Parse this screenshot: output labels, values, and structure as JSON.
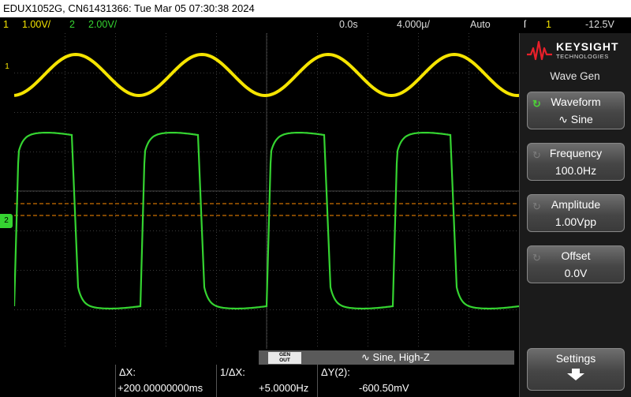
{
  "title_bar": {
    "text": "EDUX1052G, CN61431366: Tue Mar 05 07:30:38 2024"
  },
  "status_bar": {
    "ch1_num": "1",
    "ch1_scale": "1.00V/",
    "ch2_num": "2",
    "ch2_scale": "2.00V/",
    "time_offset": "0.0s",
    "time_scale": "4.000µ/",
    "trigger_mode": "Auto",
    "trigger_icon": "ſ",
    "trigger_source": "1",
    "trigger_level": "-12.5V"
  },
  "markers": {
    "ch1": "1",
    "ch2": "2"
  },
  "side_panel": {
    "brand": "KEYSIGHT",
    "brand_sub": "TECHNOLOGIES",
    "title": "Wave Gen",
    "softkeys": [
      {
        "label": "Waveform",
        "value": "∿ Sine",
        "icon": "rotate-knob-icon"
      },
      {
        "label": "Frequency",
        "value": "100.0Hz",
        "icon": "rotate-knob-icon"
      },
      {
        "label": "Amplitude",
        "value": "1.00Vpp",
        "icon": "rotate-knob-icon"
      },
      {
        "label": "Offset",
        "value": "0.0V",
        "icon": "rotate-knob-icon"
      },
      {
        "label": "Settings",
        "icon": "arrow-down-icon"
      }
    ]
  },
  "gen_bar": {
    "button_line1": "GEN",
    "button_line2": "OUT",
    "text": "∿  Sine, High-Z"
  },
  "measurements": {
    "dx_label": "ΔX:",
    "dx_value": "+200.00000000ms",
    "inv_dx_label": "1/ΔX:",
    "inv_dx_value": "+5.0000Hz",
    "dy_label": "ΔY(2):",
    "dy_value": "-600.50mV"
  },
  "colors": {
    "ch1": "#f5e400",
    "ch2": "#35d431",
    "cursor": "#ff8c00",
    "grid": "#4a4a4a"
  },
  "waveforms": {
    "ch1": {
      "shape": "sine",
      "cycles": 4
    },
    "ch2": {
      "shape": "square-rounded",
      "cycles": 4
    }
  }
}
